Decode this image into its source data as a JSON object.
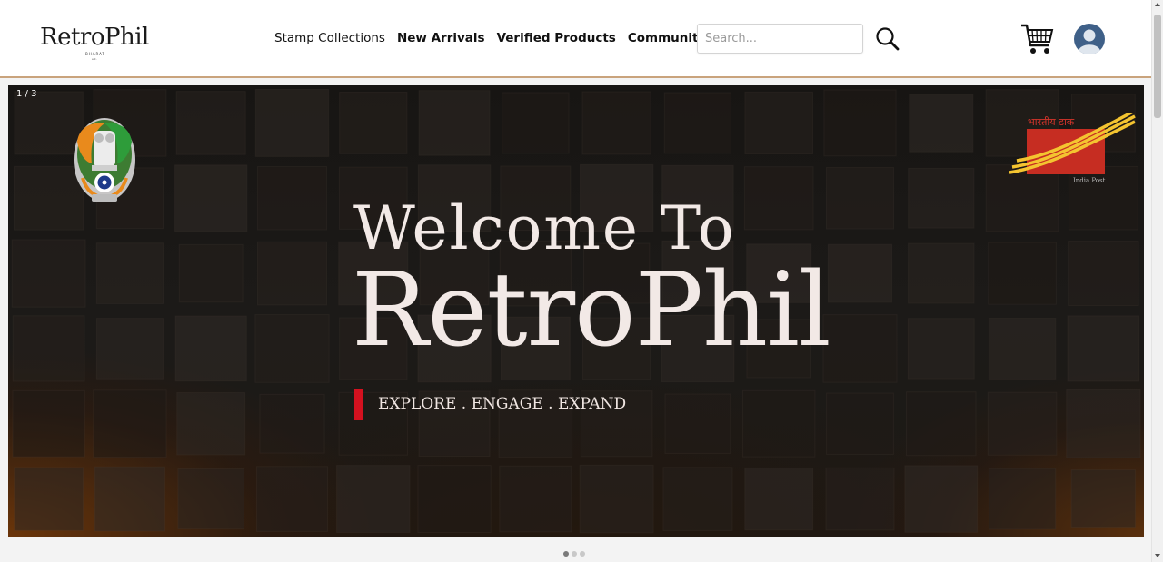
{
  "header": {
    "logo": {
      "text": "RetroPhil",
      "sub": "BHARAT",
      "sub2": "est."
    },
    "nav": [
      {
        "label": "Stamp Collections",
        "weight": "regular"
      },
      {
        "label": "New Arrivals",
        "weight": "bold"
      },
      {
        "label": "Verified Products",
        "weight": "bold"
      },
      {
        "label": "Community",
        "weight": "bold"
      }
    ],
    "search": {
      "placeholder": "Search...",
      "value": ""
    },
    "icons": {
      "search": "search-icon",
      "cart": "cart-icon",
      "profile": "user-avatar-icon"
    }
  },
  "hero": {
    "counter": "1 / 3",
    "welcome": "Welcome To",
    "brand": "RetroPhil",
    "tagline": "EXPLORE . ENGAGE . EXPAND",
    "left_logo": "national-emblem-icon",
    "right_logo": {
      "name": "india-post-logo",
      "hindi": "भारतीय डाक",
      "english": "India Post"
    },
    "slides": 3,
    "active_slide": 1
  },
  "colors": {
    "accent_border": "#c9a37c",
    "tag_bar": "#d4111f",
    "avatar": "#3f6088",
    "hero_text": "#f2e9e6"
  }
}
